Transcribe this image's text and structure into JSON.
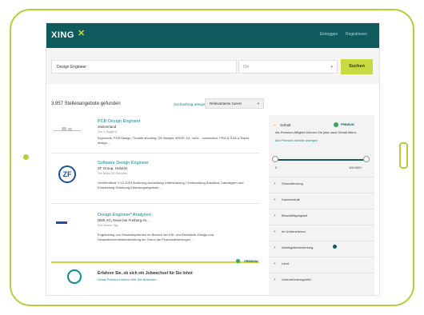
{
  "header": {
    "logo": "XING",
    "logo_mark": "✕",
    "nav": [
      "Einloggen",
      "Registrieren"
    ]
  },
  "search": {
    "query": "Design Engineer",
    "location": "Ort",
    "location_caret": "▾",
    "button": "Suchen"
  },
  "results_bar": {
    "count": "3.957 Stellenangebote gefunden",
    "save": "Suchauftrag anlegen",
    "sort_value": "Relevanteste zuerst",
    "sort_caret": "▾"
  },
  "jobs": [
    {
      "title": "PCB Design Engineer",
      "company": "Switzerland",
      "date": "Vor 1 Tag(en)",
      "desc": "Keywords: PCB Design, Trouble shooting, DE Budget, MSOE, DL, Arriv... connection, FPM & DSA & Rapid design ..."
    },
    {
      "title": "Software Design Engineer",
      "company": "ZF Group, Hubertz",
      "date": "Vor etwa 16 Stunden",
      "desc": "Veröffentlicht: 3.10.2019 Änderung Anmeldung Unterstützung / Vorbereitung Standard, Datentypen und Entwicklung Erfahrung Erfahrungsergebnis ..."
    },
    {
      "title": "Design Engineer* Analysen",
      "company": "DEB AG, Neue bei Freiburg im...",
      "date": "Vor einem Tag",
      "desc": "Engineering von Gesamtsystemen im Bereich der E/E- und Elektronik-Design und Gesamtsicherheitsentwicklung ein Grund die Prozessänderungen ..."
    }
  ],
  "premium_card": {
    "badge": "PREMIUM",
    "title": "Erfahren Sie, ob sich ein Jobwechsel für Sie lohnt",
    "link": "Gratis Premium testen Herr Sie Bewerber"
  },
  "filters": {
    "head": "Gehalt",
    "premium": "PREMIUM",
    "note": "Als Premium-Mitglied können Sie jetzt nach Gehalt filtern.",
    "link": "Alle Premium-Vorteile anzeigen",
    "slider_min": "0",
    "slider_max": "100.000+",
    "slider_range": [
      0.0,
      1.0
    ],
    "rows": [
      {
        "label": "Ortsentfernung",
        "plus": "+"
      },
      {
        "label": "Karrierestufe",
        "plus": "+"
      },
      {
        "label": "Beschäftigungsart",
        "plus": "+"
      },
      {
        "label": "Im Unternehmen",
        "plus": "+"
      },
      {
        "label": "Arbeitgeberbewertung",
        "plus": "+",
        "badge": true
      },
      {
        "label": "Land",
        "plus": "+"
      },
      {
        "label": "Unternehmensgröße",
        "plus": "+"
      }
    ]
  },
  "colors": {
    "frame": "#b8cc3a",
    "header": "#0e5a5c",
    "accent": "#c9d942",
    "link": "#0e8a8c"
  }
}
